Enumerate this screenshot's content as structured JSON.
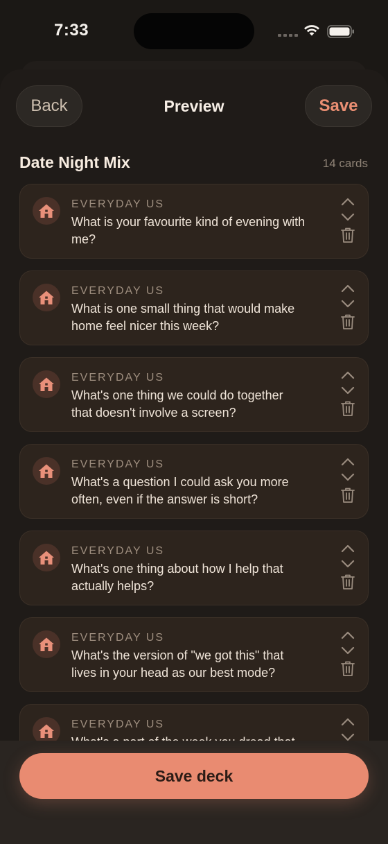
{
  "status_bar": {
    "time": "7:33"
  },
  "header": {
    "back_label": "Back",
    "title": "Preview",
    "save_label": "Save"
  },
  "deck": {
    "title": "Date Night Mix",
    "count": "14 cards"
  },
  "cards": [
    {
      "category": "EVERYDAY US",
      "question": "What is your favourite kind of evening with me?",
      "icon": "home-icon"
    },
    {
      "category": "EVERYDAY US",
      "question": "What is one small thing that would make home feel nicer this week?",
      "icon": "home-icon"
    },
    {
      "category": "EVERYDAY US",
      "question": "What's one thing we could do together that doesn't involve a screen?",
      "icon": "home-icon"
    },
    {
      "category": "EVERYDAY US",
      "question": "What's a question I could ask you more often, even if the answer is short?",
      "icon": "home-icon"
    },
    {
      "category": "EVERYDAY US",
      "question": "What's one thing about how I help that actually helps?",
      "icon": "home-icon"
    },
    {
      "category": "EVERYDAY US",
      "question": "What's the version of \"we got this\" that lives in your head as our best mode?",
      "icon": "home-icon"
    },
    {
      "category": "EVERYDAY US",
      "question": "What's a part of the week you dread that",
      "icon": "home-icon"
    }
  ],
  "footer": {
    "save_deck_label": "Save deck"
  },
  "colors": {
    "accent": "#e98b71",
    "background": "#1f1b18",
    "card": "#2d241d"
  }
}
